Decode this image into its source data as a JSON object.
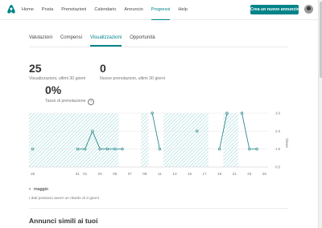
{
  "nav": {
    "items": [
      "Home",
      "Posta",
      "Prenotazioni",
      "Calendario",
      "Annuncio",
      "Progressi",
      "Help"
    ],
    "active_index": 5,
    "cta_label": "Crea un nuovo annuncio"
  },
  "tabs": {
    "items": [
      "Valutazioni",
      "Compensi",
      "Visualizzazioni",
      "Opportunità"
    ],
    "active_index": 2
  },
  "stats": {
    "views_value": "25",
    "views_label": "Visualizzazioni, ultimi 30 giorni",
    "bookings_value": "0",
    "bookings_label": "Nuove prenotazioni, ultimi 30 giorni",
    "rate_value": "0%",
    "rate_label": "Tasso di prenotazione",
    "info_glyph": "?"
  },
  "colors": {
    "accent": "#008489",
    "hatch": "#8ccfd2",
    "line": "#2b8a8e"
  },
  "chart_data": {
    "type": "line",
    "x": [
      "25",
      "26",
      "27",
      "28",
      "29",
      "30",
      "31",
      "01",
      "02",
      "03",
      "04",
      "05",
      "06",
      "07",
      "08",
      "09",
      "10",
      "11",
      "12",
      "13",
      "14",
      "15",
      "16",
      "17",
      "18",
      "19",
      "20",
      "21",
      "22",
      "23",
      "24",
      "25"
    ],
    "x_tick_labels": [
      "25",
      "",
      "",
      "",
      "",
      "",
      "31",
      "01",
      "",
      "03",
      "",
      "05",
      "",
      "07",
      "",
      "09",
      "",
      "11",
      "",
      "13",
      "",
      "15",
      "",
      "17",
      "",
      "19",
      "",
      "21",
      "",
      "23",
      "",
      "25"
    ],
    "series": [
      {
        "values": [
          1,
          null,
          null,
          null,
          null,
          null,
          1,
          1,
          2,
          1,
          1,
          1,
          1,
          null,
          null,
          null,
          3,
          1,
          null,
          null,
          null,
          null,
          2,
          null,
          null,
          1,
          3,
          null,
          3,
          1,
          1,
          null
        ]
      }
    ],
    "shaded_periods": [
      [
        0,
        6
      ],
      [
        7,
        11
      ],
      [
        15,
        15
      ],
      [
        18,
        23
      ],
      [
        26,
        27
      ]
    ],
    "ylabel": "Views",
    "y_tick_labels": [
      "0.0",
      "1.0",
      "2.0",
      "3.0"
    ],
    "ylim": [
      0,
      3
    ]
  },
  "footer": {
    "prev_label": "maggio",
    "prev_icon": "‹",
    "delay_note": "I dati possono avere un ritardo di 3 giorni",
    "similar_title": "Annunci simili ai tuoi"
  }
}
